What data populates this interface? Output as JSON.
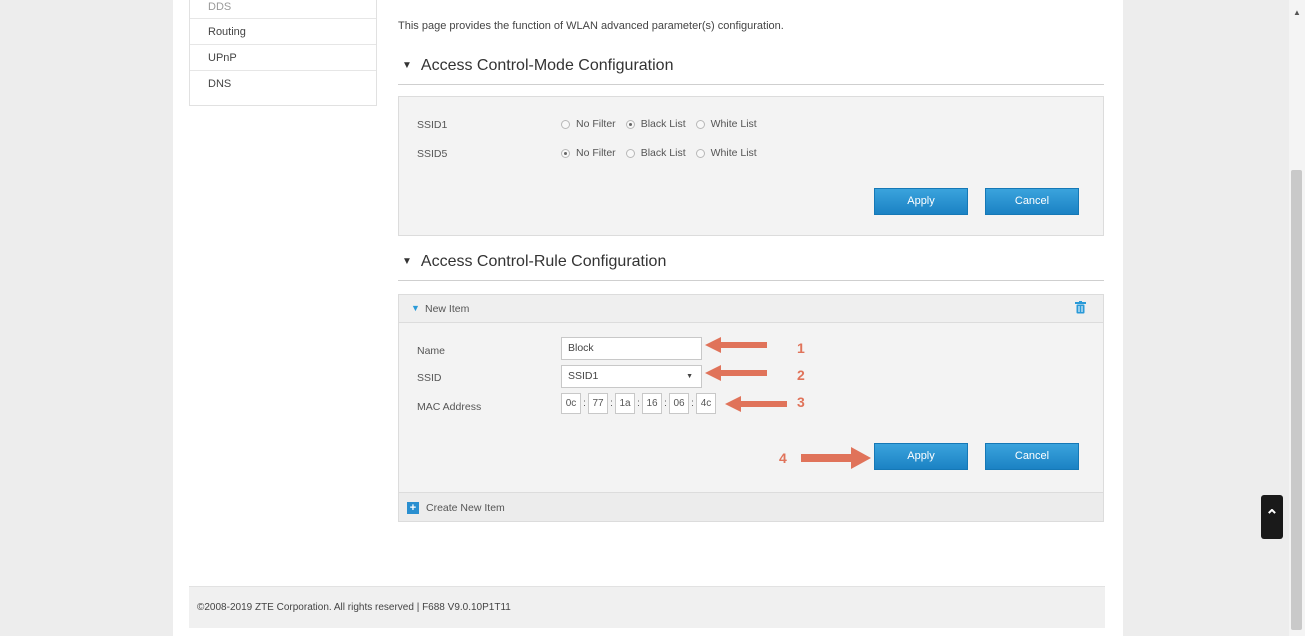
{
  "sidebar": {
    "items": [
      "DDS",
      "Routing",
      "UPnP",
      "DNS"
    ]
  },
  "intro": "This page provides the function of WLAN advanced parameter(s) configuration.",
  "mode_section": {
    "title": "Access Control-Mode Configuration",
    "rows": [
      {
        "label": "SSID1",
        "selected": "Black List"
      },
      {
        "label": "SSID5",
        "selected": "No Filter"
      }
    ],
    "options": [
      "No Filter",
      "Black List",
      "White List"
    ],
    "apply": "Apply",
    "cancel": "Cancel"
  },
  "rule_section": {
    "title": "Access Control-Rule Configuration",
    "item_title": "New Item",
    "name_label": "Name",
    "name_value": "Block",
    "ssid_label": "SSID",
    "ssid_value": "SSID1",
    "mac_label": "MAC Address",
    "mac": [
      "0c",
      "77",
      "1a",
      "16",
      "06",
      "4c"
    ],
    "apply": "Apply",
    "cancel": "Cancel",
    "create": "Create New Item"
  },
  "annotations": [
    "1",
    "2",
    "3",
    "4"
  ],
  "footer": "©2008-2019 ZTE Corporation. All rights reserved  |  F688 V9.0.10P1T11",
  "colors": {
    "accent": "#1b82c4",
    "annotation": "#e0735a"
  },
  "icons": {
    "trash": "trash-icon",
    "plus": "plus-icon",
    "to_top": "double-chevron-up-icon"
  }
}
